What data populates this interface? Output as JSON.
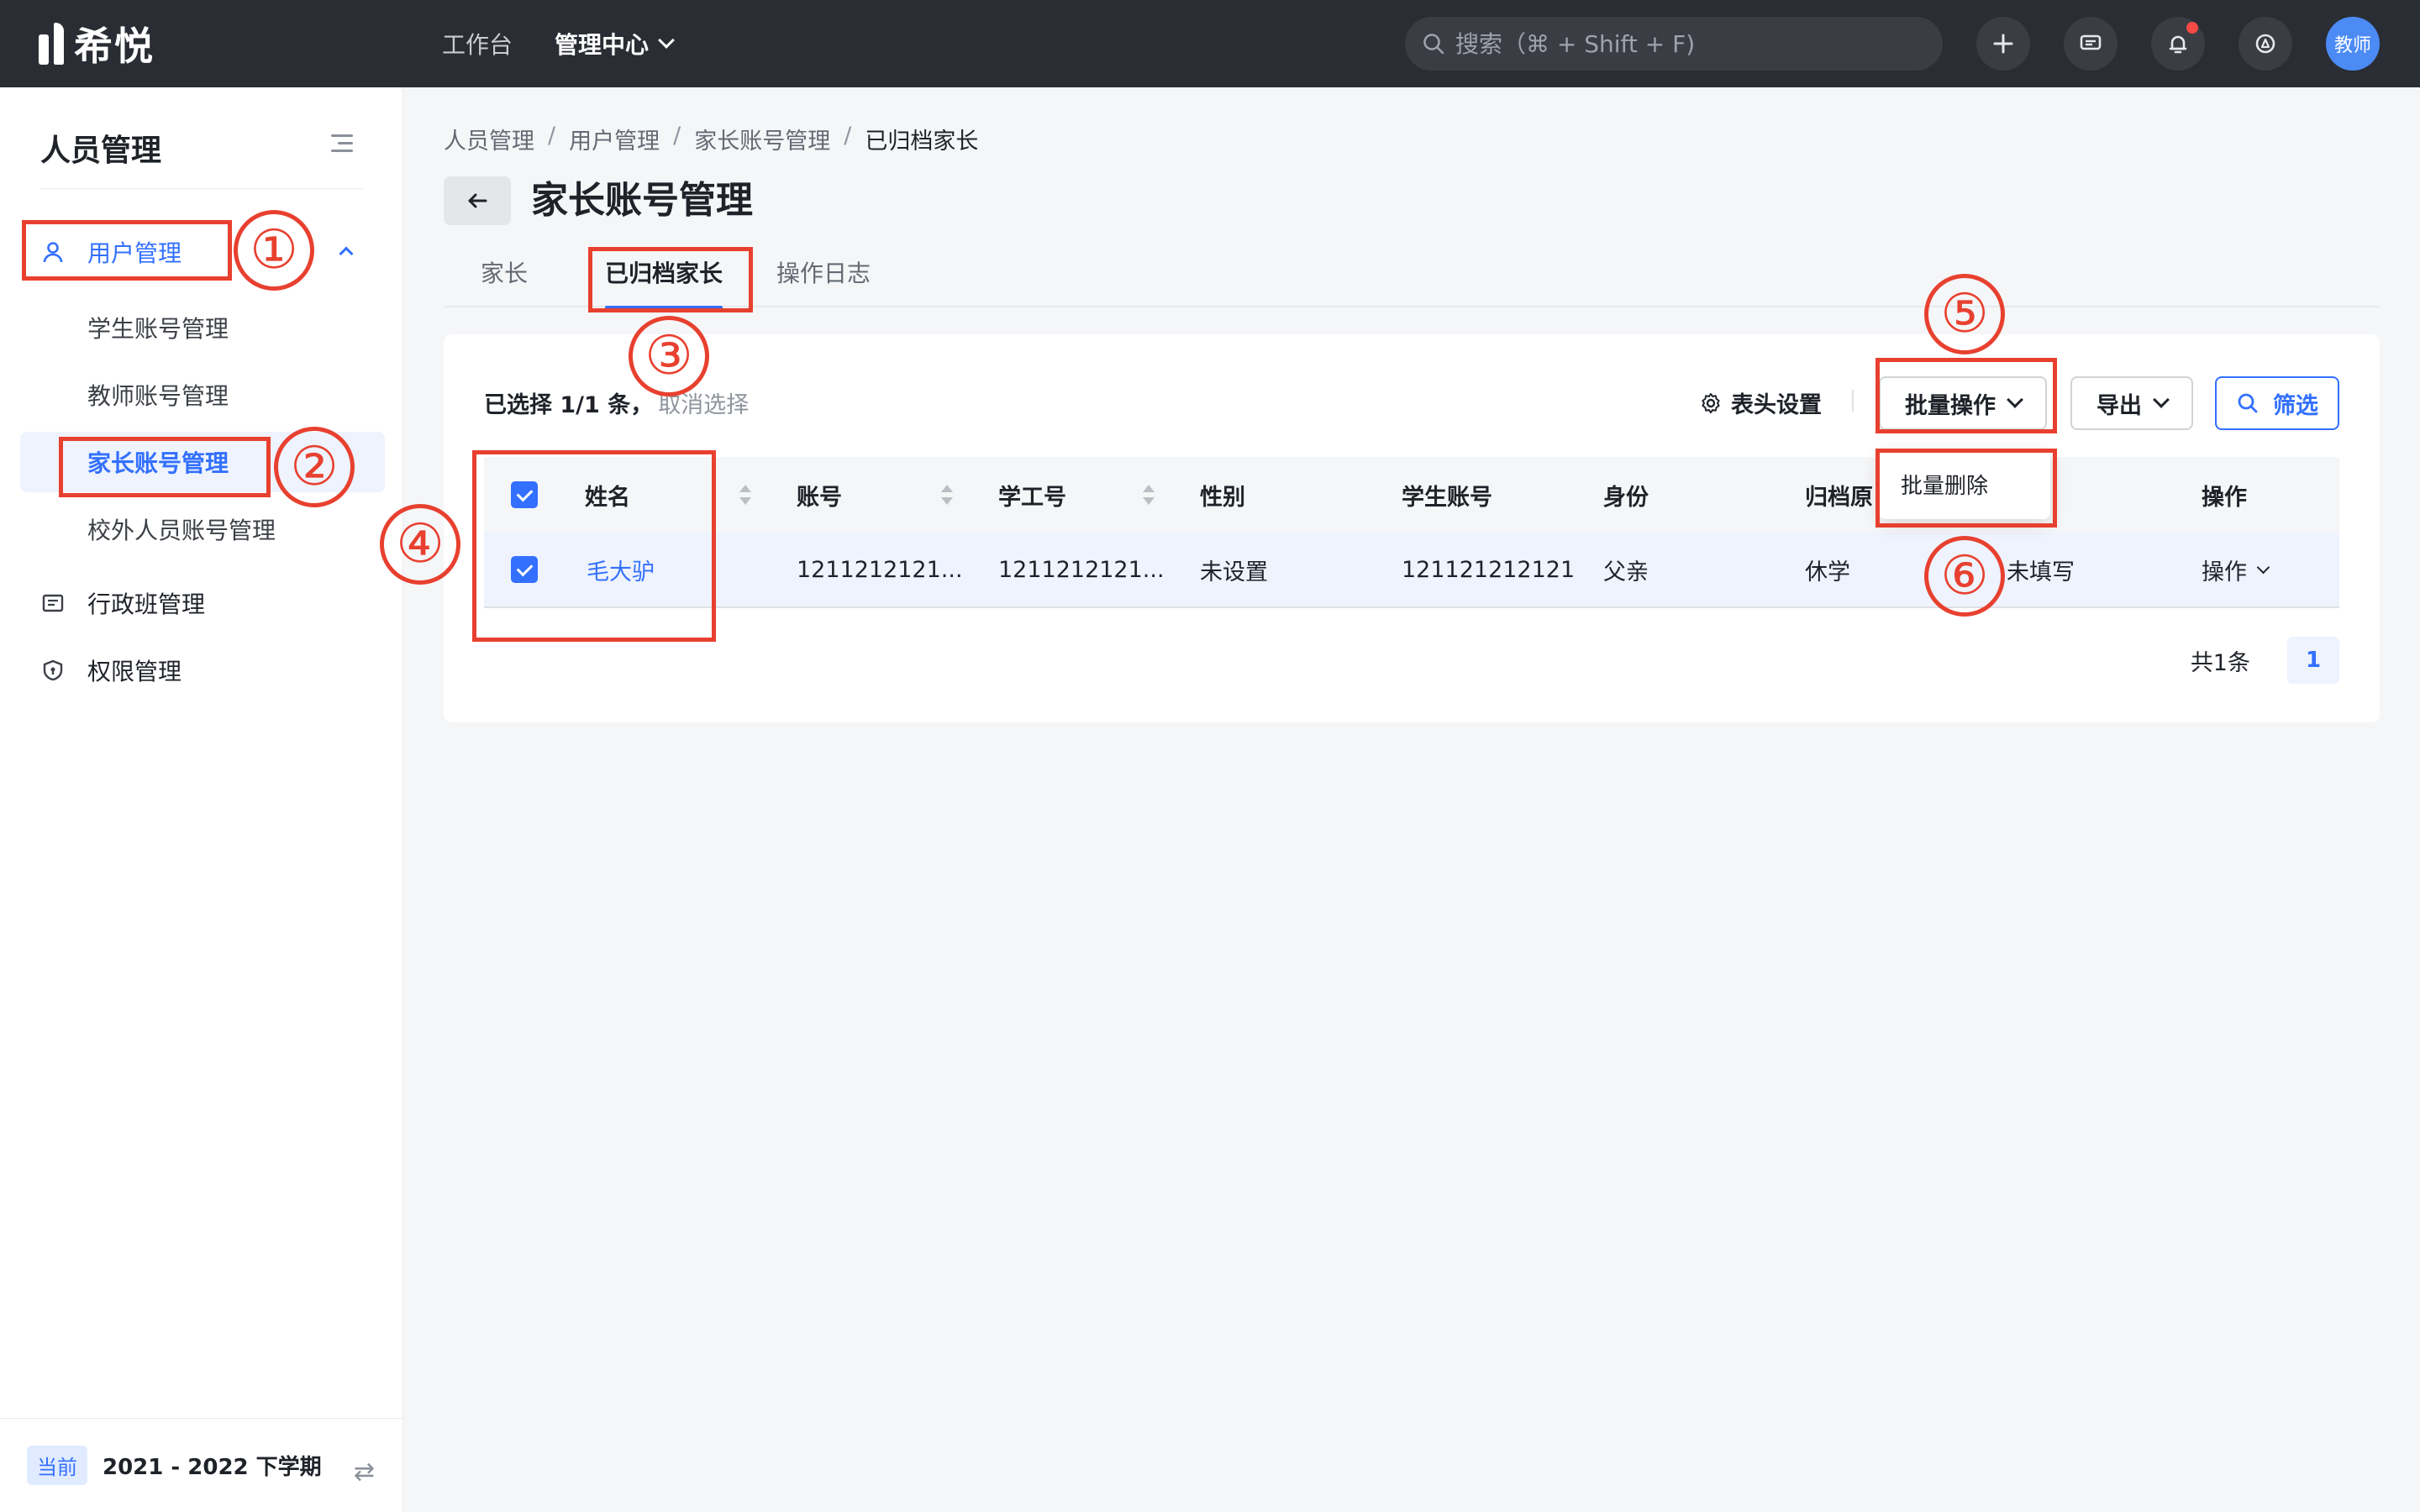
{
  "app": {
    "name": "希悦"
  },
  "topnav": {
    "items": [
      "工作台",
      "管理中心"
    ]
  },
  "search": {
    "placeholder": "搜索（⌘ + Shift + F)"
  },
  "user": {
    "avatar_text": "教师"
  },
  "sidebar": {
    "title": "人员管理",
    "items": [
      {
        "label": "用户管理",
        "icon": "user-icon"
      },
      {
        "label": "行政班管理",
        "icon": "class-icon"
      },
      {
        "label": "权限管理",
        "icon": "shield-icon"
      }
    ],
    "subitems": [
      "学生账号管理",
      "教师账号管理",
      "家长账号管理",
      "校外人员账号管理"
    ],
    "footer": {
      "badge": "当前",
      "term": "2021 - 2022 下学期"
    }
  },
  "breadcrumb": [
    "人员管理",
    "用户管理",
    "家长账号管理",
    "已归档家长"
  ],
  "page": {
    "title": "家长账号管理"
  },
  "tabs": [
    "家长",
    "已归档家长",
    "操作日志"
  ],
  "toolbar": {
    "selected_text": "已选择 1/1 条，",
    "cancel_text": "取消选择",
    "header_settings": "表头设置",
    "batch_ops": "批量操作",
    "export": "导出",
    "filter": "筛选"
  },
  "dropdown": {
    "items": [
      "批量删除"
    ]
  },
  "table": {
    "columns": [
      "姓名",
      "账号",
      "学工号",
      "性别",
      "学生账号",
      "身份",
      "归档原",
      "操作"
    ],
    "rows": [
      {
        "name": "毛大驴",
        "account": "1211212121...",
        "staff_no": "1211212121...",
        "gender": "未设置",
        "student_account": "121121212121",
        "identity": "父亲",
        "archive_reason": "休学",
        "extra": "未填写",
        "action": "操作"
      }
    ]
  },
  "pagination": {
    "total": "共1条",
    "current": "1"
  },
  "annotations": [
    "①",
    "②",
    "③",
    "④",
    "⑤",
    "⑥"
  ],
  "colors": {
    "accent": "#3370ff",
    "annotation": "#e8402f",
    "topbar": "#2a2d33"
  }
}
